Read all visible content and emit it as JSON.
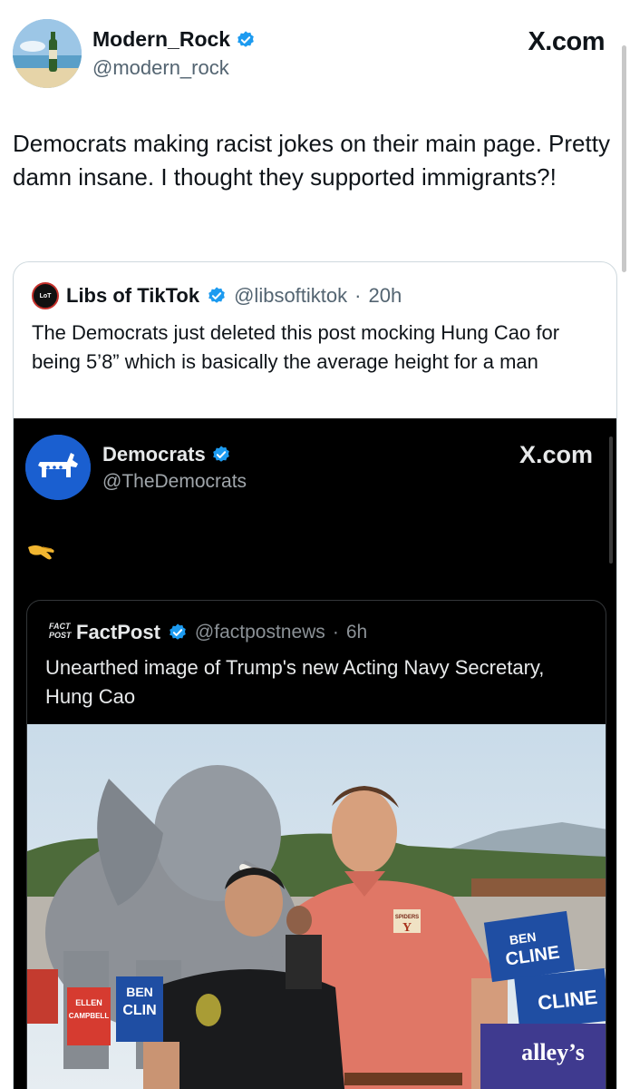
{
  "tweet": {
    "author_name": "Modern_Rock",
    "author_handle": "@modern_rock",
    "brand": "X.com",
    "text": "Democrats making racist jokes on their main page. Pretty damn insane.  I thought they supported immigrants?!"
  },
  "quoted": {
    "author_name": "Libs of TikTok",
    "author_handle": "@libsoftiktok",
    "separator": "·",
    "time": "20h",
    "text": "The Democrats just deleted this post mocking Hung Cao for being 5’8” which is basically the average height for a man"
  },
  "embedded": {
    "author_name": "Democrats",
    "author_handle": "@TheDemocrats",
    "brand": "X.com",
    "emoji_icon": "pinching-hand-icon",
    "inner": {
      "logo_text_1": "FACT",
      "logo_text_2": "POST",
      "author_name": "FactPost",
      "author_handle": "@factpostnews",
      "separator": "·",
      "time": "6h",
      "text": "Unearthed image of Trump's new Acting Navy Secretary, Hung Cao",
      "photo": {
        "sign_ben_1": "BEN",
        "sign_clin": "CLIN",
        "sign_ellen": "ELLEN",
        "sign_campbell": "CAMPBELL",
        "sign_ben_2": "BEN",
        "sign_cline_1": "CLINE",
        "sign_cline_2": "CLINE",
        "banner": "alley’s",
        "shirt_logo": "SPIDERS"
      }
    }
  },
  "colors": {
    "verified_blue": "#1d9bf0",
    "text_dark": "#0f1419",
    "text_muted": "#536471",
    "embed_bg": "#000000",
    "democrats_blue": "#1a5fd0"
  }
}
